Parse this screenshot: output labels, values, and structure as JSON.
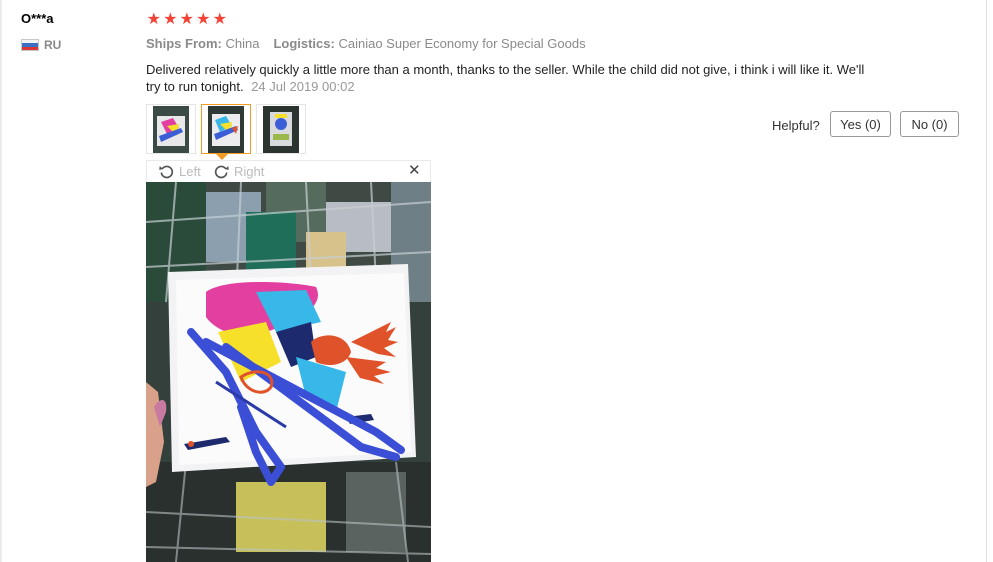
{
  "review": {
    "user_name": "O***a",
    "country_code": "RU",
    "rating": 5,
    "star_glyph": "★",
    "ships_from_label": "Ships From:",
    "ships_from_value": "China",
    "logistics_label": "Logistics:",
    "logistics_value": "Cainiao Super Economy for Special Goods",
    "text": "Delivered relatively quickly a little more than a month, thanks to the seller. While the child did not give, i think i will like it. We'll try to run tonight.",
    "date": "24 Jul 2019 00:02"
  },
  "helpful": {
    "label": "Helpful?",
    "yes_label": "Yes (0)",
    "no_label": "No (0)"
  },
  "viewer": {
    "rotate_left_label": "Left",
    "rotate_right_label": "Right",
    "close_glyph": "✕",
    "thumbnail_count": 3,
    "active_thumbnail": 2
  },
  "colors": {
    "star": "#f44336",
    "active_thumb_border": "#f59a23",
    "muted_text": "#8a8a8a"
  },
  "icons": [
    "russia-flag-icon",
    "star-icon",
    "rotate-left-icon",
    "rotate-right-icon",
    "close-icon"
  ]
}
